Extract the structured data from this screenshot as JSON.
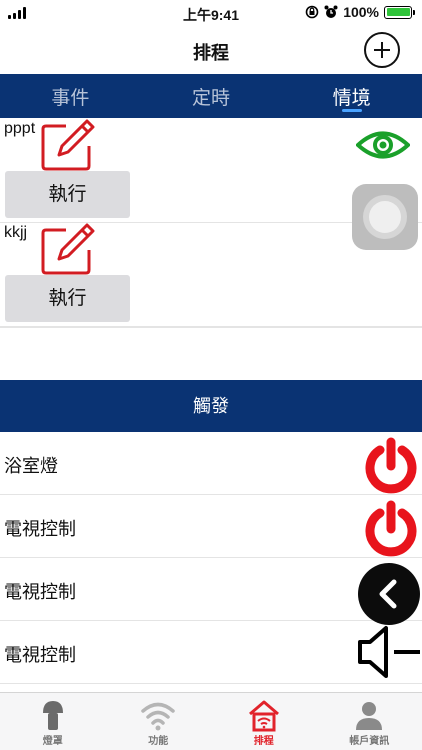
{
  "status_bar": {
    "time": "上午9:41",
    "battery": "100%"
  },
  "nav": {
    "title": "排程"
  },
  "tabs": [
    {
      "label": "事件",
      "active": false
    },
    {
      "label": "定時",
      "active": false
    },
    {
      "label": "情境",
      "active": true
    }
  ],
  "scenes": [
    {
      "name": "pppt",
      "run_label": "執行"
    },
    {
      "name": "kkjj",
      "run_label": "執行"
    }
  ],
  "trigger": {
    "header": "觸發",
    "items": [
      {
        "label": "浴室燈",
        "icon": "power-icon"
      },
      {
        "label": "電視控制",
        "icon": "power-icon"
      },
      {
        "label": "電視控制",
        "icon": "back-icon"
      },
      {
        "label": "電視控制",
        "icon": "speaker-icon"
      }
    ]
  },
  "tabbar": [
    {
      "label": "燈罩",
      "icon": "lamp-icon",
      "active": false
    },
    {
      "label": "功能",
      "icon": "wifi-icon",
      "active": false
    },
    {
      "label": "排程",
      "icon": "home-wifi-icon",
      "active": true
    },
    {
      "label": "帳戶資訊",
      "icon": "user-icon",
      "active": false
    }
  ],
  "colors": {
    "accent_blue": "#0a3373",
    "power_red": "#e8141c",
    "eye_green": "#1aa02a",
    "tab_active": "#e1232b"
  }
}
